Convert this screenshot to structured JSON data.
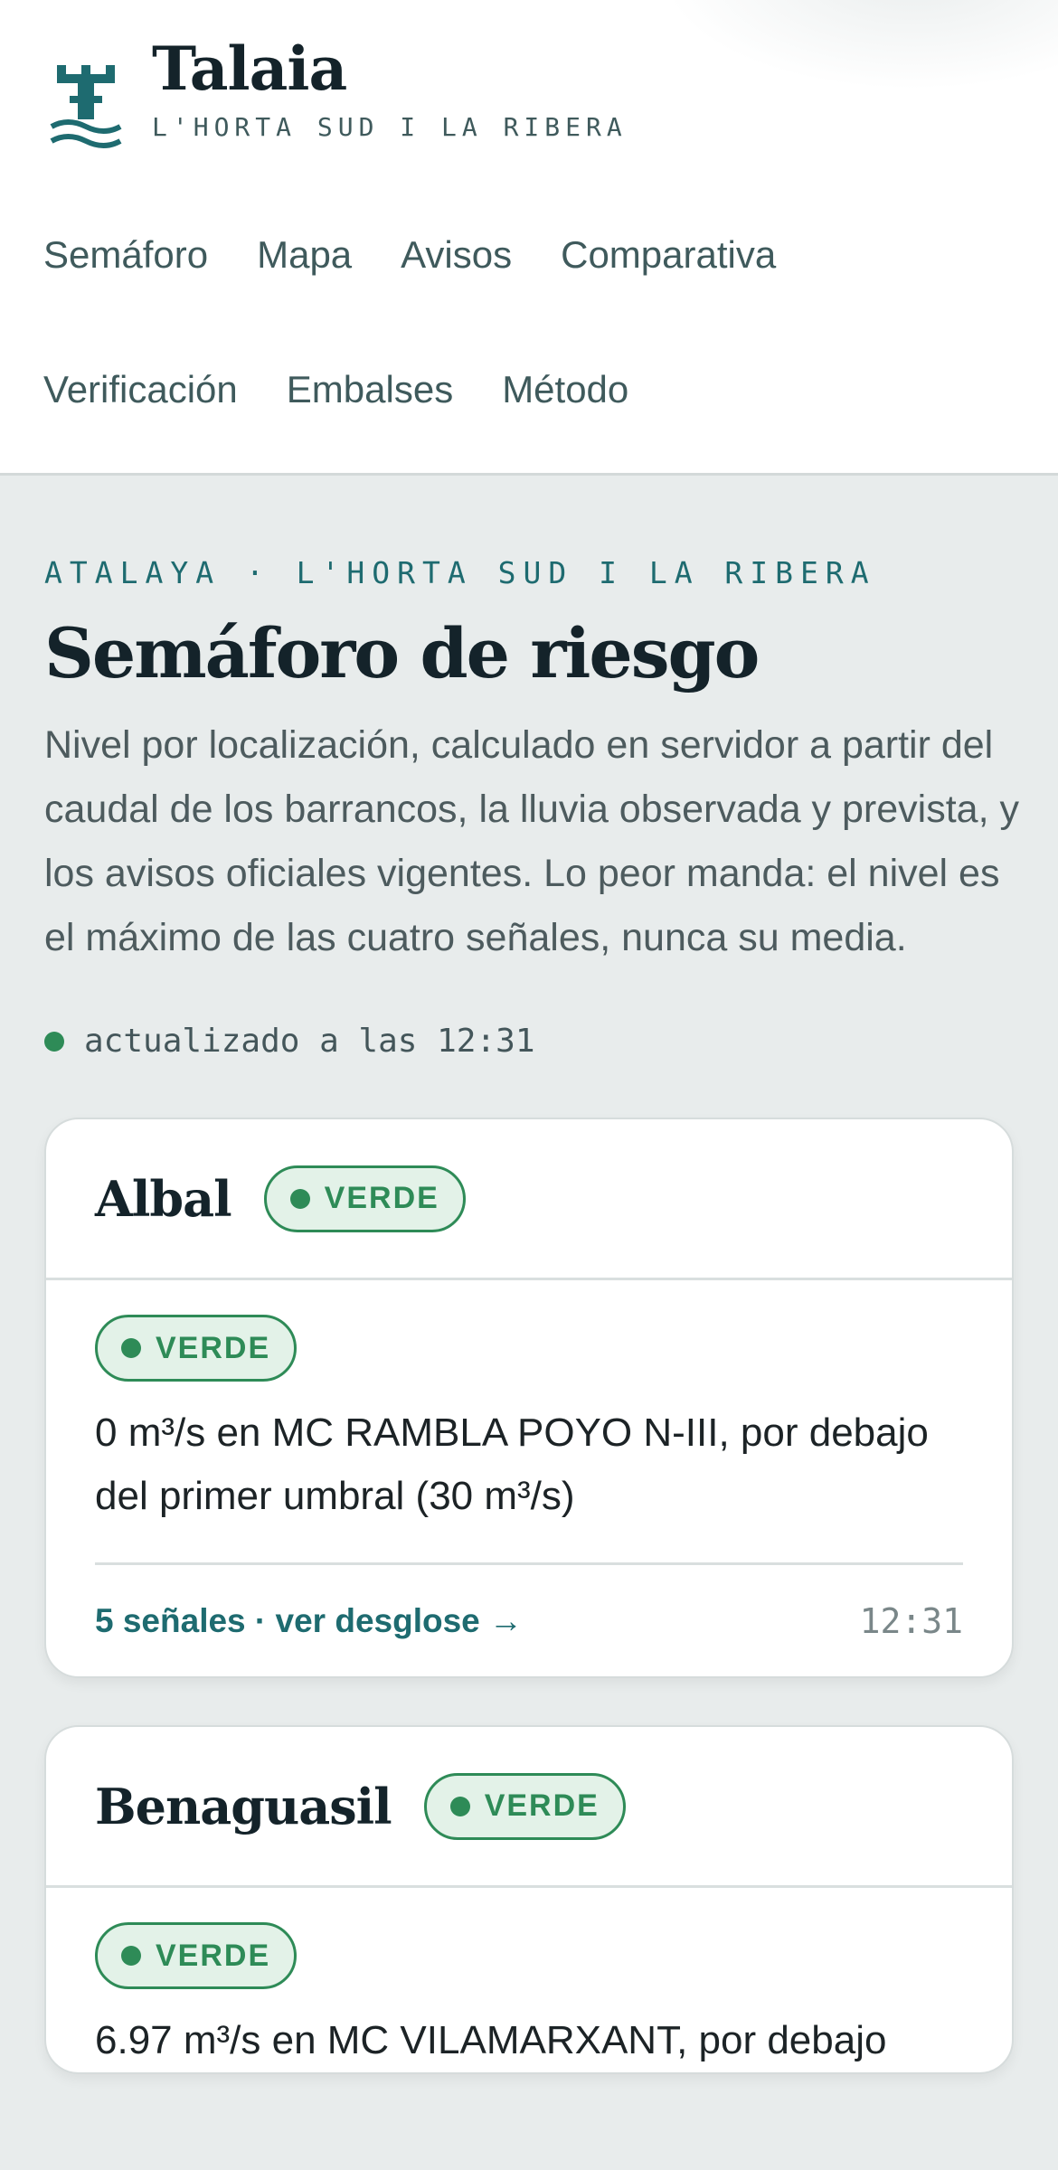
{
  "brand": {
    "title": "Talaia",
    "subtitle": "L'HORTA SUD I LA RIBERA",
    "logo_icon": "watchtower-waves-icon",
    "color": "#1e6b70"
  },
  "nav": {
    "items": [
      {
        "label": "Semáforo"
      },
      {
        "label": "Mapa"
      },
      {
        "label": "Avisos"
      },
      {
        "label": "Comparativa"
      },
      {
        "label": "Verificación"
      },
      {
        "label": "Embalses"
      },
      {
        "label": "Método"
      }
    ]
  },
  "main": {
    "eyebrow": "ATALAYA · L'HORTA SUD I LA RIBERA",
    "title": "Semáforo de riesgo",
    "lead": "Nivel por localización, calculado en servidor a partir del caudal de los barrancos, la lluvia observada y prevista, y los avisos oficiales vigentes. Lo peor manda: el nivel es el máximo de las cuatro señales, nunca su media.",
    "updated": "actualizado a las 12:31",
    "updated_status_color": "#2e8b57"
  },
  "cards": [
    {
      "name": "Albal",
      "level": "VERDE",
      "signal_level": "VERDE",
      "signal_text": "0 m³/s en MC RAMBLA POYO N-III, por debajo del primer umbral (30 m³/s)",
      "link": "5 señales · ver desglose →",
      "time": "12:31"
    },
    {
      "name": "Benaguasil",
      "level": "VERDE",
      "signal_level": "VERDE",
      "signal_text": "6.97 m³/s en MC VILAMARXANT, por debajo",
      "link": "",
      "time": ""
    }
  ],
  "colors": {
    "accent": "#1e6b70",
    "level_green": "#2e8b57",
    "level_green_bg": "#e3f2e8"
  }
}
